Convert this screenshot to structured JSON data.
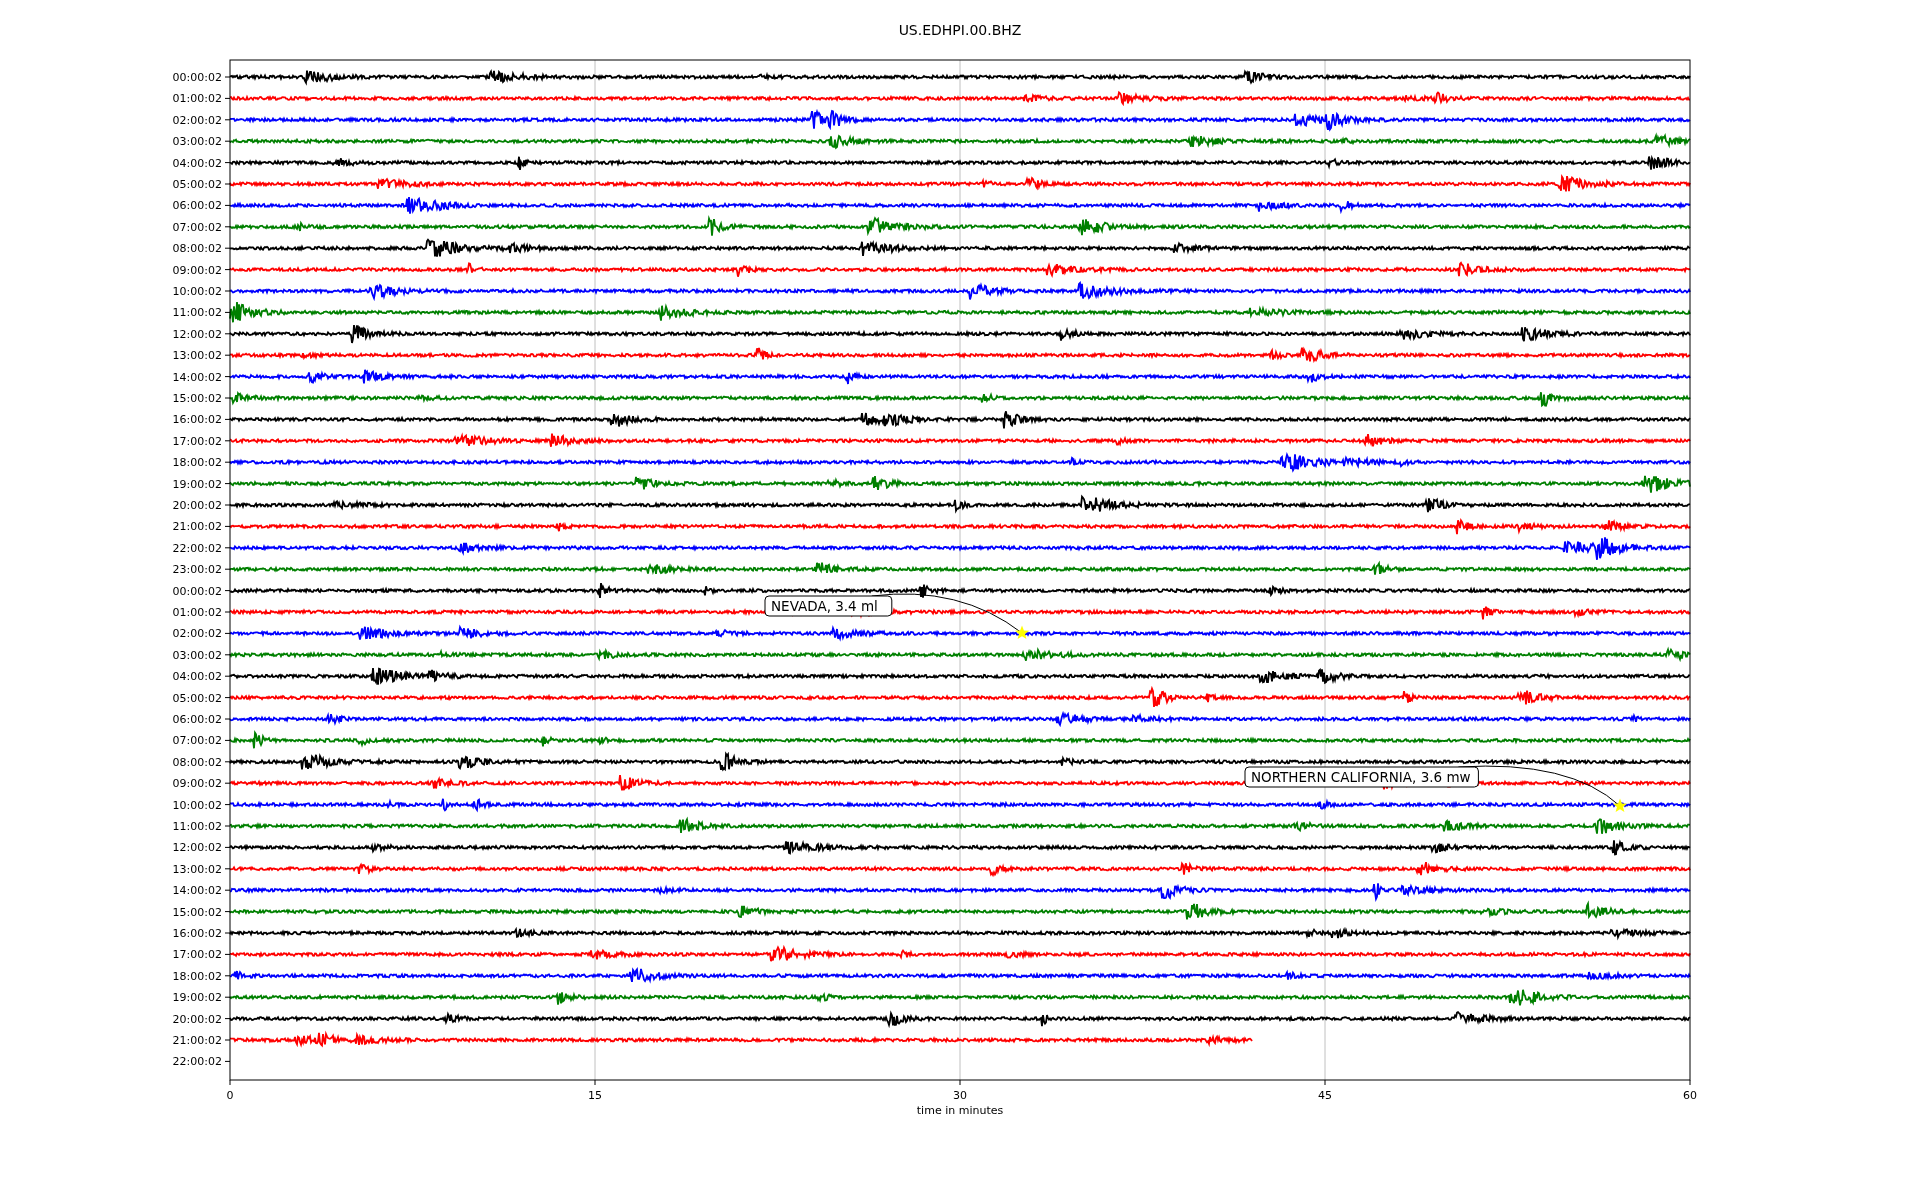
{
  "title": "US.EDHPI.00.BHZ",
  "traces": [
    {
      "label": "00:00:02",
      "color": "#000000",
      "level": 1
    },
    {
      "label": "01:00:02",
      "color": "#ff0000",
      "level": 1
    },
    {
      "label": "02:00:02",
      "color": "#0000ff",
      "level": 1
    },
    {
      "label": "03:00:02",
      "color": "#008000",
      "level": 1
    },
    {
      "label": "04:00:02",
      "color": "#000000",
      "level": 1
    },
    {
      "label": "05:00:02",
      "color": "#ff0000",
      "level": 1
    },
    {
      "label": "06:00:02",
      "color": "#0000ff",
      "level": 1
    },
    {
      "label": "07:00:02",
      "color": "#008000",
      "level": 1
    },
    {
      "label": "08:00:02",
      "color": "#000000",
      "level": 1
    },
    {
      "label": "09:00:02",
      "color": "#ff0000",
      "level": 1
    },
    {
      "label": "10:00:02",
      "color": "#0000ff",
      "level": 1
    },
    {
      "label": "11:00:02",
      "color": "#008000",
      "level": 1
    },
    {
      "label": "12:00:02",
      "color": "#000000",
      "level": 1
    },
    {
      "label": "13:00:02",
      "color": "#ff0000",
      "level": 1
    },
    {
      "label": "14:00:02",
      "color": "#0000ff",
      "level": 1
    },
    {
      "label": "15:00:02",
      "color": "#008000",
      "level": 1
    },
    {
      "label": "16:00:02",
      "color": "#000000",
      "level": 1
    },
    {
      "label": "17:00:02",
      "color": "#ff0000",
      "level": 1
    },
    {
      "label": "18:00:02",
      "color": "#0000ff",
      "level": 1
    },
    {
      "label": "19:00:02",
      "color": "#008000",
      "level": 1
    },
    {
      "label": "20:00:02",
      "color": "#000000",
      "level": 1
    },
    {
      "label": "21:00:02",
      "color": "#ff0000",
      "level": 1
    },
    {
      "label": "22:00:02",
      "color": "#0000ff",
      "level": 1
    },
    {
      "label": "23:00:02",
      "color": "#008000",
      "level": 1
    },
    {
      "label": "00:00:02",
      "color": "#000000",
      "level": 1
    },
    {
      "label": "01:00:02",
      "color": "#ff0000",
      "level": 1
    },
    {
      "label": "02:00:02",
      "color": "#0000ff",
      "level": 1
    },
    {
      "label": "03:00:02",
      "color": "#008000",
      "level": 1
    },
    {
      "label": "04:00:02",
      "color": "#000000",
      "level": 1
    },
    {
      "label": "05:00:02",
      "color": "#ff0000",
      "level": 1
    },
    {
      "label": "06:00:02",
      "color": "#0000ff",
      "level": 1
    },
    {
      "label": "07:00:02",
      "color": "#008000",
      "level": 1
    },
    {
      "label": "08:00:02",
      "color": "#000000",
      "level": 1
    },
    {
      "label": "09:00:02",
      "color": "#ff0000",
      "level": 1
    },
    {
      "label": "10:00:02",
      "color": "#0000ff",
      "level": 1
    },
    {
      "label": "11:00:02",
      "color": "#008000",
      "level": 1
    },
    {
      "label": "12:00:02",
      "color": "#000000",
      "level": 1
    },
    {
      "label": "13:00:02",
      "color": "#ff0000",
      "level": 1
    },
    {
      "label": "14:00:02",
      "color": "#0000ff",
      "level": 1
    },
    {
      "label": "15:00:02",
      "color": "#008000",
      "level": 1
    },
    {
      "label": "16:00:02",
      "color": "#000000",
      "level": 1
    },
    {
      "label": "17:00:02",
      "color": "#ff0000",
      "level": 1
    },
    {
      "label": "18:00:02",
      "color": "#0000ff",
      "level": 1
    },
    {
      "label": "19:00:02",
      "color": "#008000",
      "level": 1
    },
    {
      "label": "20:00:02",
      "color": "#000000",
      "level": 1
    },
    {
      "label": "21:00:02",
      "color": "#ff0000",
      "level": 0.7
    },
    {
      "label": "22:00:02"
    }
  ],
  "x_ticks": [
    "0",
    "15",
    "30",
    "45",
    "60"
  ],
  "xlabel": "time in minutes",
  "annotations": [
    {
      "text": "NEVADA, 3.4 ml"
    },
    {
      "text": "NORTHERN CALIFORNIA, 3.6 mw"
    }
  ]
}
